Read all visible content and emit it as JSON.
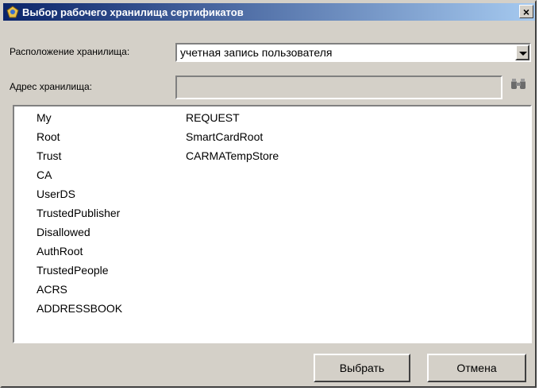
{
  "window": {
    "title": "Выбор рабочего хранилища сертификатов",
    "close_glyph": "×"
  },
  "location": {
    "label": "Расположение хранилища:",
    "value": "учетная запись пользователя"
  },
  "address": {
    "label": "Адрес хранилища:",
    "value": ""
  },
  "stores": {
    "column1": [
      "My",
      "Root",
      "Trust",
      "CA",
      "UserDS",
      "TrustedPublisher",
      "Disallowed",
      "AuthRoot",
      "TrustedPeople",
      "ACRS",
      "ADDRESSBOOK"
    ],
    "column2": [
      "REQUEST",
      "SmartCardRoot",
      "CARMATempStore"
    ]
  },
  "buttons": {
    "select_label": "Выбрать",
    "cancel_label": "Отмена"
  },
  "icons": {
    "title": "certificate-app-icon",
    "browse": "binoculars-icon",
    "dropdown": "dropdown-arrow-icon"
  },
  "colors": {
    "titlebar_start": "#0a246a",
    "titlebar_end": "#a6caf0",
    "face": "#d4d0c8"
  }
}
